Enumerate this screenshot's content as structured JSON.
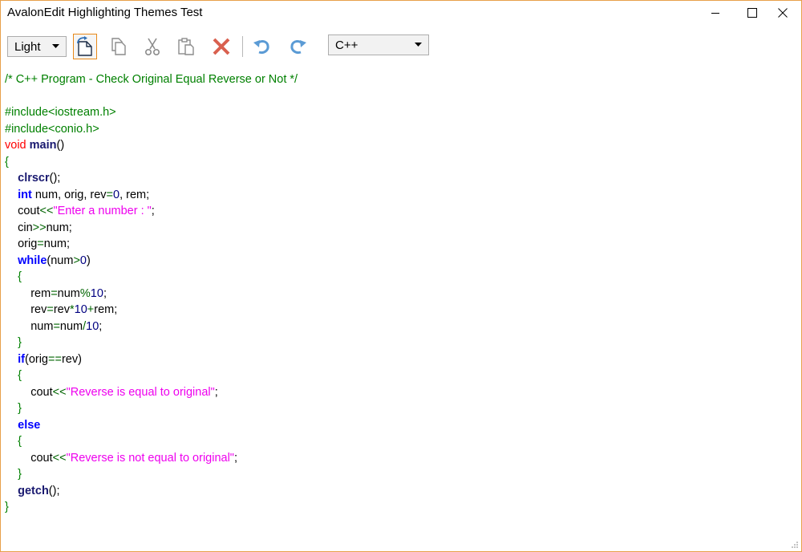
{
  "window": {
    "title": "AvalonEdit Highlighting Themes Test",
    "accent_color": "#e8a04a"
  },
  "toolbar": {
    "theme_select": {
      "value": "Light"
    },
    "language_select": {
      "value": "C++"
    },
    "buttons": [
      "new-document-icon",
      "copy-icon",
      "cut-icon",
      "paste-icon",
      "delete-icon",
      "undo-icon",
      "redo-icon"
    ]
  },
  "editor": {
    "language": "C++",
    "colors": {
      "comment": "#008000",
      "preprocessor": "#008000",
      "keyword": "#0000ff",
      "function": "#191970",
      "string": "#ee00ee",
      "void": "#ff0000"
    },
    "lines": [
      [
        {
          "t": "/* C++ Program - Check Original Equal Reverse or Not */",
          "c": "cm"
        }
      ],
      [],
      [
        {
          "t": "#include<iostream.h>",
          "c": "pp"
        }
      ],
      [
        {
          "t": "#include<conio.h>",
          "c": "pp"
        }
      ],
      [
        {
          "t": "void",
          "c": "vd"
        },
        {
          "t": " "
        },
        {
          "t": "main",
          "c": "fn"
        },
        {
          "t": "()"
        }
      ],
      [
        {
          "t": "{",
          "c": "br"
        }
      ],
      [
        {
          "t": "    "
        },
        {
          "t": "clrscr",
          "c": "fn"
        },
        {
          "t": "();"
        }
      ],
      [
        {
          "t": "    "
        },
        {
          "t": "int",
          "c": "tp"
        },
        {
          "t": " num, orig, rev"
        },
        {
          "t": "=",
          "c": "op"
        },
        {
          "t": "0",
          "c": "nm"
        },
        {
          "t": ", rem;"
        }
      ],
      [
        {
          "t": "    cout"
        },
        {
          "t": "<<",
          "c": "op"
        },
        {
          "t": "\"Enter a number : \"",
          "c": "st"
        },
        {
          "t": ";"
        }
      ],
      [
        {
          "t": "    cin"
        },
        {
          "t": ">>",
          "c": "op"
        },
        {
          "t": "num;"
        }
      ],
      [
        {
          "t": "    orig"
        },
        {
          "t": "=",
          "c": "op"
        },
        {
          "t": "num;"
        }
      ],
      [
        {
          "t": "    "
        },
        {
          "t": "while",
          "c": "kw"
        },
        {
          "t": "(num"
        },
        {
          "t": ">",
          "c": "op"
        },
        {
          "t": "0",
          "c": "nm"
        },
        {
          "t": ")"
        }
      ],
      [
        {
          "t": "    "
        },
        {
          "t": "{",
          "c": "br"
        }
      ],
      [
        {
          "t": "        rem"
        },
        {
          "t": "=",
          "c": "op"
        },
        {
          "t": "num"
        },
        {
          "t": "%",
          "c": "op"
        },
        {
          "t": "10",
          "c": "nm"
        },
        {
          "t": ";"
        }
      ],
      [
        {
          "t": "        rev"
        },
        {
          "t": "=",
          "c": "op"
        },
        {
          "t": "rev"
        },
        {
          "t": "*",
          "c": "op"
        },
        {
          "t": "10",
          "c": "nm"
        },
        {
          "t": "+",
          "c": "op"
        },
        {
          "t": "rem;"
        }
      ],
      [
        {
          "t": "        num"
        },
        {
          "t": "=",
          "c": "op"
        },
        {
          "t": "num"
        },
        {
          "t": "/",
          "c": "op"
        },
        {
          "t": "10",
          "c": "nm"
        },
        {
          "t": ";"
        }
      ],
      [
        {
          "t": "    "
        },
        {
          "t": "}",
          "c": "br"
        }
      ],
      [
        {
          "t": "    "
        },
        {
          "t": "if",
          "c": "kw"
        },
        {
          "t": "(orig"
        },
        {
          "t": "==",
          "c": "op"
        },
        {
          "t": "rev)"
        }
      ],
      [
        {
          "t": "    "
        },
        {
          "t": "{",
          "c": "br"
        }
      ],
      [
        {
          "t": "        cout"
        },
        {
          "t": "<<",
          "c": "op"
        },
        {
          "t": "\"Reverse is equal to original\"",
          "c": "st"
        },
        {
          "t": ";"
        }
      ],
      [
        {
          "t": "    "
        },
        {
          "t": "}",
          "c": "br"
        }
      ],
      [
        {
          "t": "    "
        },
        {
          "t": "else",
          "c": "kw"
        }
      ],
      [
        {
          "t": "    "
        },
        {
          "t": "{",
          "c": "br"
        }
      ],
      [
        {
          "t": "        cout"
        },
        {
          "t": "<<",
          "c": "op"
        },
        {
          "t": "\"Reverse is not equal to original\"",
          "c": "st"
        },
        {
          "t": ";"
        }
      ],
      [
        {
          "t": "    "
        },
        {
          "t": "}",
          "c": "br"
        }
      ],
      [
        {
          "t": "    "
        },
        {
          "t": "getch",
          "c": "fn"
        },
        {
          "t": "();"
        }
      ],
      [
        {
          "t": "}",
          "c": "br"
        }
      ]
    ]
  }
}
